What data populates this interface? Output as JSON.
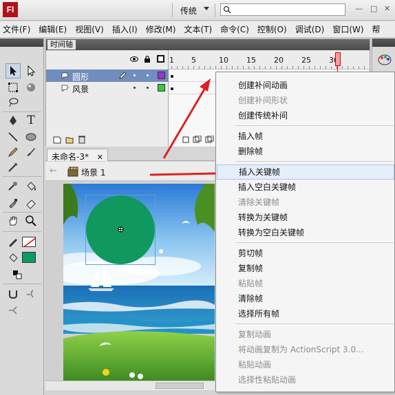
{
  "app": {
    "logo": "Fl",
    "workspace": "传统",
    "search_placeholder": "",
    "window_buttons": [
      "—",
      "□",
      "✕"
    ]
  },
  "menubar": {
    "items": [
      "文件(F)",
      "编辑(E)",
      "视图(V)",
      "插入(I)",
      "修改(M)",
      "文本(T)",
      "命令(C)",
      "控制(O)",
      "调试(D)",
      "窗口(W)",
      "帮"
    ]
  },
  "timeline": {
    "tab": "时间轴",
    "ruler_numbers": [
      "1",
      "5",
      "10",
      "15",
      "20",
      "25",
      "30"
    ],
    "layers": [
      {
        "name": "圆形",
        "color": "#9933cc",
        "selected": true
      },
      {
        "name": "风景",
        "color": "#33cc33",
        "selected": false
      }
    ]
  },
  "document": {
    "tab_label": "未命名-3*",
    "scene_label": "场景 1"
  },
  "tools": {
    "stroke_color": "#ff0000",
    "fill_color": "#0f9a62"
  },
  "context_menu": {
    "groups": [
      [
        {
          "label": "创建补间动画",
          "enabled": true
        },
        {
          "label": "创建补间形状",
          "enabled": false
        },
        {
          "label": "创建传统补间",
          "enabled": true
        }
      ],
      [
        {
          "label": "插入帧",
          "enabled": true
        },
        {
          "label": "删除帧",
          "enabled": true
        }
      ],
      [
        {
          "label": "插入关键帧",
          "enabled": true,
          "highlighted": true
        },
        {
          "label": "插入空白关键帧",
          "enabled": true
        },
        {
          "label": "清除关键帧",
          "enabled": false
        },
        {
          "label": "转换为关键帧",
          "enabled": true
        },
        {
          "label": "转换为空白关键帧",
          "enabled": true
        }
      ],
      [
        {
          "label": "剪切帧",
          "enabled": true
        },
        {
          "label": "复制帧",
          "enabled": true
        },
        {
          "label": "粘贴帧",
          "enabled": false
        },
        {
          "label": "清除帧",
          "enabled": true
        },
        {
          "label": "选择所有帧",
          "enabled": true
        }
      ],
      [
        {
          "label": "复制动画",
          "enabled": false
        },
        {
          "label": "将动画复制为 ActionScript 3.0...",
          "enabled": false
        },
        {
          "label": "粘贴动画",
          "enabled": false
        },
        {
          "label": "选择性粘贴动画",
          "enabled": false
        }
      ]
    ]
  },
  "colors": {
    "accent_red": "#e02020",
    "circle_fill": "#10985f",
    "menu_highlight": "#e5eef9"
  }
}
